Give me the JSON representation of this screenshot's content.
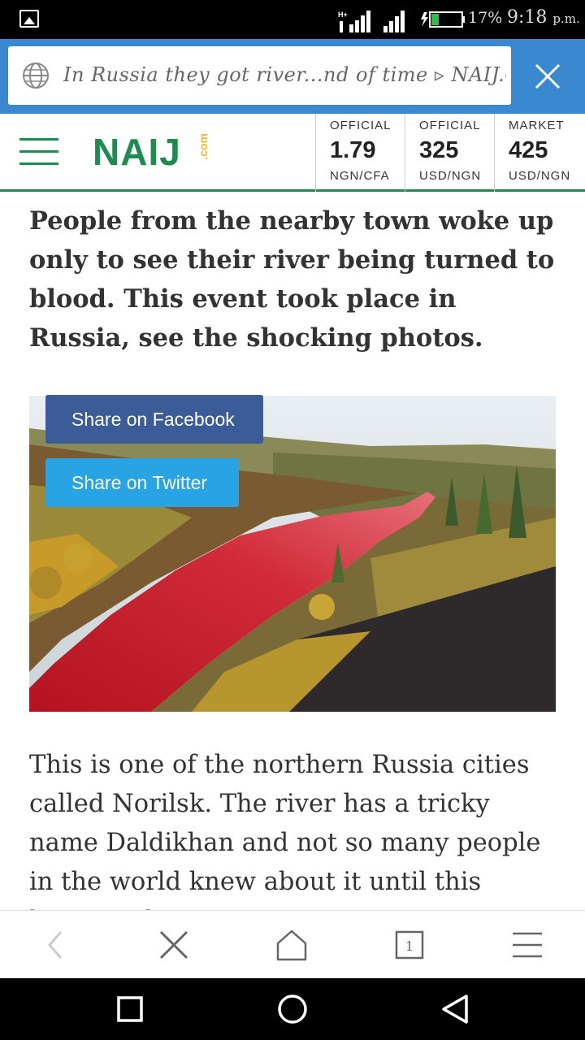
{
  "status_bar": {
    "battery_percent": "17%",
    "time": "9:18",
    "time_suffix": "p.m.",
    "network_label": "H+"
  },
  "url_bar": {
    "url_text": "In Russia they got river...nd of time ▹ NAIJ.COM",
    "accent_color": "#3a88cf"
  },
  "site_header": {
    "logo_text": "NAIJ",
    "logo_suffix": ".com",
    "brand_color": "#1e8c50",
    "rates": [
      {
        "kind": "OFFICIAL",
        "value": "1.79",
        "pair": "NGN/CFA"
      },
      {
        "kind": "OFFICIAL",
        "value": "325",
        "pair": "USD/NGN"
      },
      {
        "kind": "MARKET",
        "value": "425",
        "pair": "USD/NGN"
      }
    ]
  },
  "article": {
    "headline": "People from the nearby town woke up only to see their river being turned to blood. This event took place in Russia, see the shocking photos.",
    "share_facebook": "Share on Facebook",
    "share_twitter": "Share on Twitter",
    "body": "This is one of the northern Russia cities called Norilsk. The river has a tricky name Daldikhan and not so many people in the world knew about it until this happened."
  },
  "toolbar": {
    "tab_count": "1",
    "icons": [
      "back-icon",
      "close-icon",
      "home-icon",
      "tabs-icon",
      "menu-icon"
    ]
  },
  "navbar": {
    "icons": [
      "recent-apps-icon",
      "home-circle-icon",
      "back-triangle-icon"
    ]
  }
}
